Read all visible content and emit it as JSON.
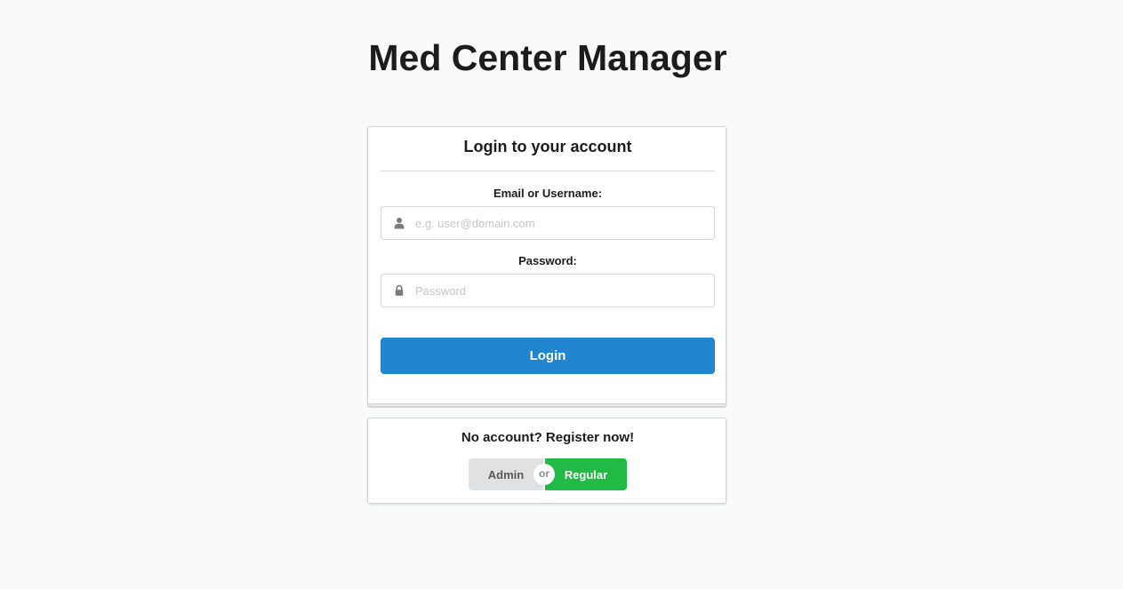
{
  "app": {
    "title": "Med Center Manager"
  },
  "login": {
    "header": "Login to your account",
    "email_label": "Email or Username:",
    "email_placeholder": "e.g. user@domain.com",
    "email_value": "",
    "email_icon": "user-icon",
    "password_label": "Password:",
    "password_placeholder": "Password",
    "password_value": "",
    "password_icon": "lock-icon",
    "button_label": "Login"
  },
  "register": {
    "prompt": "No account? Register now!",
    "admin_label": "Admin",
    "or_label": "or",
    "regular_label": "Regular"
  },
  "colors": {
    "background": "#f9fafa",
    "primary": "#2185d0",
    "positive": "#21ba45",
    "secondary": "#e0e1e2"
  }
}
